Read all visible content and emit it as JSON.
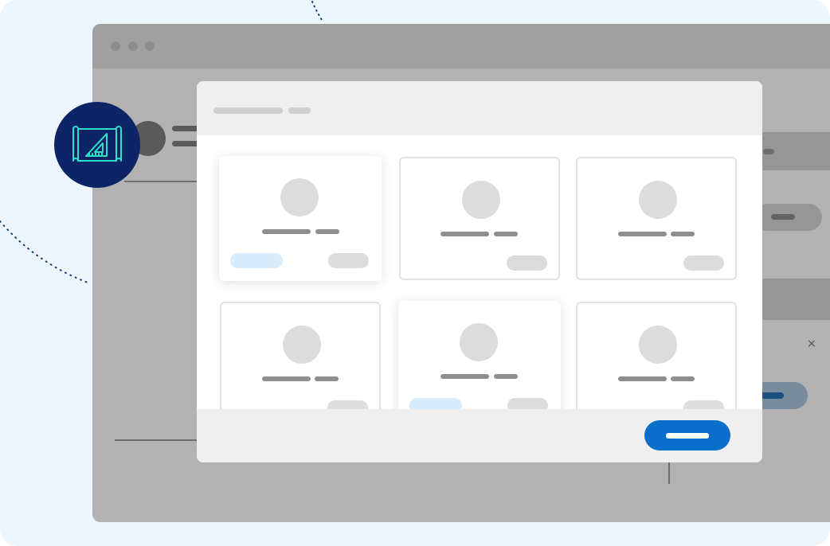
{
  "illustration": {
    "colors": {
      "background": "#eef6fd",
      "badge": "#0d2466",
      "badge_icon": "#2ee0c8",
      "primary_button": "#0a6fca",
      "selected_tag": "#d9ecfb",
      "dotted_arc": "#0d3c7a"
    },
    "badge_icon": "blueprint-set-square-icon",
    "window_controls": [
      "dot",
      "dot",
      "dot"
    ]
  },
  "modal": {
    "title": "",
    "cards": [
      {
        "selected": true,
        "has_tag": true
      },
      {
        "selected": false,
        "has_tag": false
      },
      {
        "selected": false,
        "has_tag": false
      },
      {
        "selected": false,
        "has_tag": false
      },
      {
        "selected": true,
        "has_tag": true
      },
      {
        "selected": false,
        "has_tag": false
      }
    ],
    "confirm_label": ""
  }
}
